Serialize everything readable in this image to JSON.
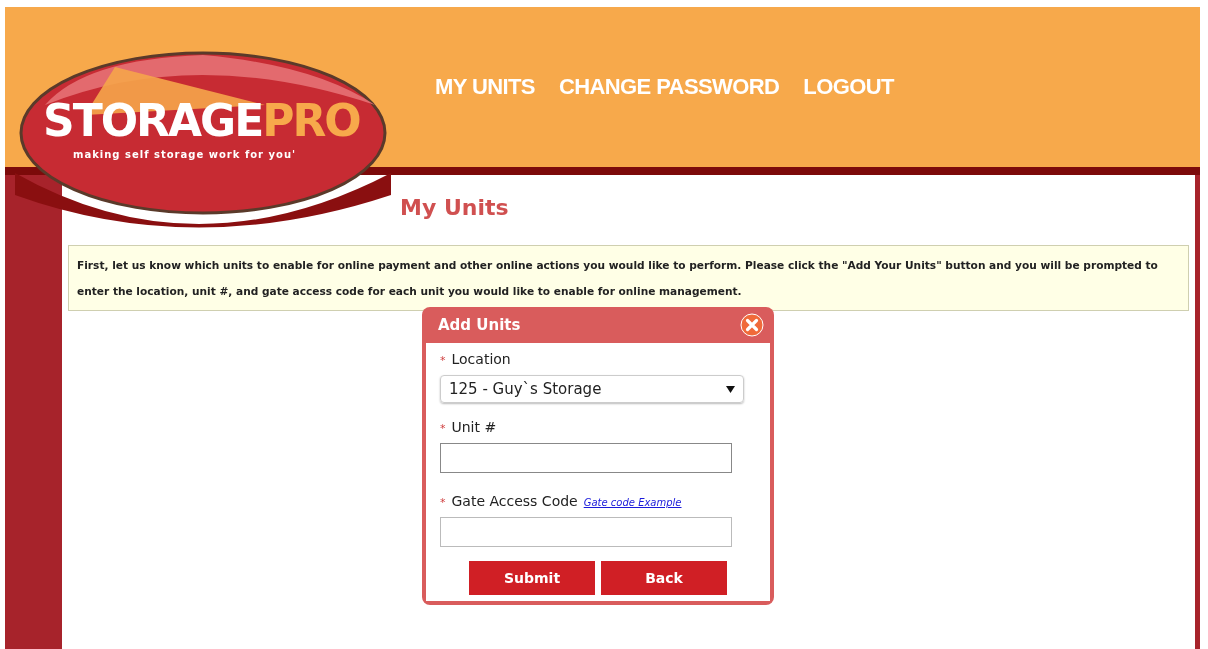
{
  "logo": {
    "wordmark": [
      "STORAGE",
      "PRO"
    ],
    "tagline": "making self storage work for you'"
  },
  "nav": [
    "MY UNITS",
    "CHANGE PASSWORD",
    "LOGOUT"
  ],
  "page_title": "My Units",
  "notice": "First, let us know which units to enable for online payment and other online actions you would like to perform. Please click the \"Add Your Units\" button and you will be prompted to enter the location, unit #, and gate access code for each unit you would like to enable for online management.",
  "dialog": {
    "title": "Add Units",
    "fields": [
      {
        "kind": "select",
        "required_mark": "*",
        "label": "Location",
        "value": "125 - Guy`s Storage"
      },
      {
        "kind": "text",
        "required_mark": "*",
        "label": "Unit #",
        "focused": true
      },
      {
        "kind": "text",
        "required_mark": "*",
        "label": "Gate Access Code",
        "link": "Gate code Example",
        "focused": false
      }
    ],
    "buttons": [
      "Submit",
      "Back"
    ]
  }
}
